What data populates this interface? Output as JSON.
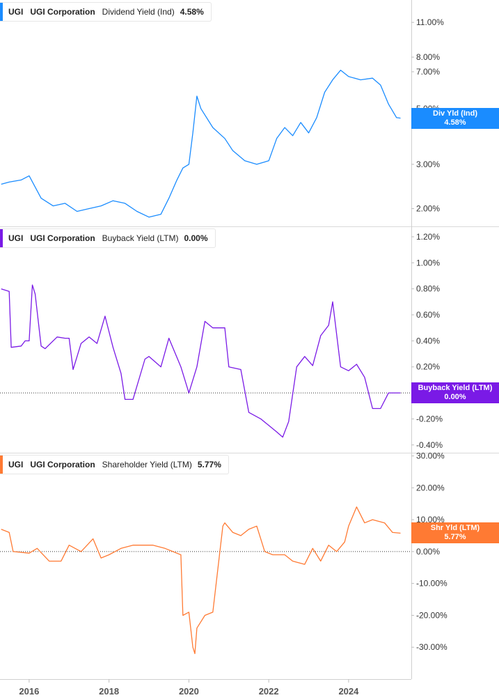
{
  "chart_data": [
    {
      "type": "line",
      "ticker": "UGI",
      "company": "UGI Corporation",
      "metric": "Dividend Yield (Ind)",
      "current_value": "4.58%",
      "tag_label": "Div Yld (Ind)",
      "color": "#1a8cff",
      "scale": "log",
      "ylim": [
        1.7,
        13.5
      ],
      "yticks": [
        11,
        8,
        7,
        5,
        3,
        2
      ],
      "ytick_labels": [
        "11.00%",
        "8.00%",
        "7.00%",
        "5.00%",
        "3.00%",
        "2.00%"
      ],
      "x": [
        2015.3,
        2015.5,
        2015.8,
        2016.0,
        2016.3,
        2016.6,
        2016.9,
        2017.2,
        2017.5,
        2017.8,
        2018.1,
        2018.4,
        2018.7,
        2019.0,
        2019.3,
        2019.5,
        2019.7,
        2019.85,
        2020.0,
        2020.1,
        2020.2,
        2020.3,
        2020.6,
        2020.9,
        2021.1,
        2021.4,
        2021.7,
        2022.0,
        2022.2,
        2022.4,
        2022.6,
        2022.8,
        2023.0,
        2023.2,
        2023.4,
        2023.6,
        2023.8,
        2024.0,
        2024.3,
        2024.6,
        2024.8,
        2025.0,
        2025.2,
        2025.3
      ],
      "y": [
        2.5,
        2.55,
        2.6,
        2.7,
        2.2,
        2.05,
        2.1,
        1.95,
        2.0,
        2.05,
        2.15,
        2.1,
        1.95,
        1.85,
        1.9,
        2.2,
        2.6,
        2.9,
        3.0,
        4.0,
        5.6,
        5.0,
        4.2,
        3.8,
        3.4,
        3.1,
        3.0,
        3.1,
        3.8,
        4.2,
        3.9,
        4.4,
        4.0,
        4.6,
        5.8,
        6.5,
        7.1,
        6.7,
        6.5,
        6.6,
        6.2,
        5.2,
        4.6,
        4.58
      ]
    },
    {
      "type": "line",
      "ticker": "UGI",
      "company": "UGI Corporation",
      "metric": "Buyback Yield (LTM)",
      "current_value": "0.00%",
      "tag_label": "Buyback Yield (LTM)",
      "color": "#7a1ae6",
      "ylim": [
        -0.46,
        1.28
      ],
      "zero_line": true,
      "yticks": [
        1.2,
        1.0,
        0.8,
        0.6,
        0.4,
        0.2,
        -0.2,
        -0.4
      ],
      "ytick_labels": [
        "1.20%",
        "1.00%",
        "0.80%",
        "0.60%",
        "0.40%",
        "0.20%",
        "-0.20%",
        "-0.40%"
      ],
      "x": [
        2015.3,
        2015.5,
        2015.55,
        2015.8,
        2015.9,
        2016.0,
        2016.08,
        2016.15,
        2016.3,
        2016.4,
        2016.7,
        2016.9,
        2017.0,
        2017.1,
        2017.3,
        2017.5,
        2017.7,
        2017.9,
        2018.1,
        2018.3,
        2018.4,
        2018.6,
        2018.9,
        2019.0,
        2019.3,
        2019.5,
        2019.8,
        2020.0,
        2020.2,
        2020.4,
        2020.6,
        2020.9,
        2021.0,
        2021.3,
        2021.5,
        2021.8,
        2022.0,
        2022.2,
        2022.35,
        2022.5,
        2022.7,
        2022.9,
        2023.1,
        2023.3,
        2023.5,
        2023.6,
        2023.8,
        2024.0,
        2024.2,
        2024.4,
        2024.6,
        2024.8,
        2025.0,
        2025.3
      ],
      "y": [
        0.8,
        0.78,
        0.35,
        0.36,
        0.4,
        0.4,
        0.83,
        0.76,
        0.36,
        0.34,
        0.43,
        0.42,
        0.42,
        0.18,
        0.38,
        0.43,
        0.38,
        0.59,
        0.35,
        0.15,
        -0.05,
        -0.05,
        0.26,
        0.28,
        0.2,
        0.42,
        0.2,
        0.0,
        0.2,
        0.55,
        0.5,
        0.5,
        0.2,
        0.18,
        -0.15,
        -0.2,
        -0.25,
        -0.3,
        -0.34,
        -0.22,
        0.2,
        0.28,
        0.21,
        0.44,
        0.52,
        0.7,
        0.2,
        0.17,
        0.22,
        0.12,
        -0.12,
        -0.12,
        0.0,
        0.0
      ]
    },
    {
      "type": "line",
      "ticker": "UGI",
      "company": "UGI Corporation",
      "metric": "Shareholder Yield (LTM)",
      "current_value": "5.77%",
      "tag_label": "Shr Yld (LTM)",
      "color": "#ff7a33",
      "ylim": [
        -40,
        31
      ],
      "zero_line": true,
      "yticks": [
        30,
        20,
        10,
        0,
        -10,
        -20,
        -30
      ],
      "ytick_labels": [
        "30.00%",
        "20.00%",
        "10.00%",
        "0.00%",
        "-10.00%",
        "-20.00%",
        "-30.00%"
      ],
      "x": [
        2015.3,
        2015.5,
        2015.6,
        2016.0,
        2016.2,
        2016.5,
        2016.8,
        2017.0,
        2017.3,
        2017.6,
        2017.8,
        2018.0,
        2018.3,
        2018.6,
        2018.9,
        2019.1,
        2019.4,
        2019.6,
        2019.8,
        2019.85,
        2020.0,
        2020.1,
        2020.15,
        2020.2,
        2020.4,
        2020.6,
        2020.85,
        2020.9,
        2021.1,
        2021.3,
        2021.5,
        2021.7,
        2021.9,
        2022.1,
        2022.4,
        2022.6,
        2022.9,
        2023.1,
        2023.3,
        2023.5,
        2023.7,
        2023.9,
        2024.0,
        2024.2,
        2024.4,
        2024.6,
        2024.9,
        2025.1,
        2025.3
      ],
      "y": [
        7,
        6,
        0,
        -0.5,
        1,
        -3,
        -3,
        2,
        0,
        4,
        -2,
        -1,
        1,
        2,
        2,
        2,
        1,
        0,
        -1,
        -20,
        -19,
        -30,
        -32,
        -24,
        -20,
        -19,
        8,
        9,
        6,
        5,
        7,
        8,
        0,
        -1,
        -1,
        -3,
        -4,
        1,
        -3,
        2,
        0,
        3,
        8,
        14,
        9,
        10,
        9,
        6,
        5.77
      ]
    }
  ],
  "x_axis": {
    "range": [
      2015.27,
      2025.57
    ],
    "ticks": [
      2016,
      2018,
      2020,
      2022,
      2024
    ],
    "tick_labels": [
      "2016",
      "2018",
      "2020",
      "2022",
      "2024"
    ]
  }
}
